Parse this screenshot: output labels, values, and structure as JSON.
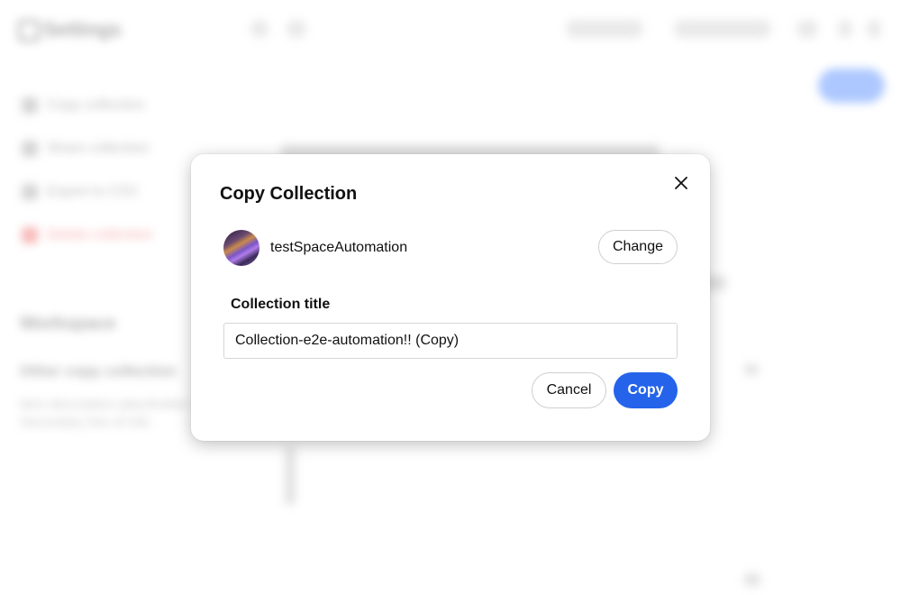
{
  "background": {
    "app_title": "Settings",
    "nav_items": [
      "Copy collection",
      "Share collection",
      "Export to CSV",
      "Delete collection"
    ],
    "section_heading": "Workspace",
    "section_item": "Other copy collection",
    "section_desc_lines": [
      "Item description placeholder",
      "Secondary line of info"
    ]
  },
  "dialog": {
    "title": "Copy Collection",
    "close_icon": "close-icon",
    "space": {
      "name": "testSpaceAutomation",
      "change_label": "Change"
    },
    "field_label": "Collection title",
    "title_value": "Collection-e2e-automation!! (Copy)",
    "cancel_label": "Cancel",
    "copy_label": "Copy"
  },
  "colors": {
    "primary": "#2563eb",
    "danger": "#e33333"
  }
}
